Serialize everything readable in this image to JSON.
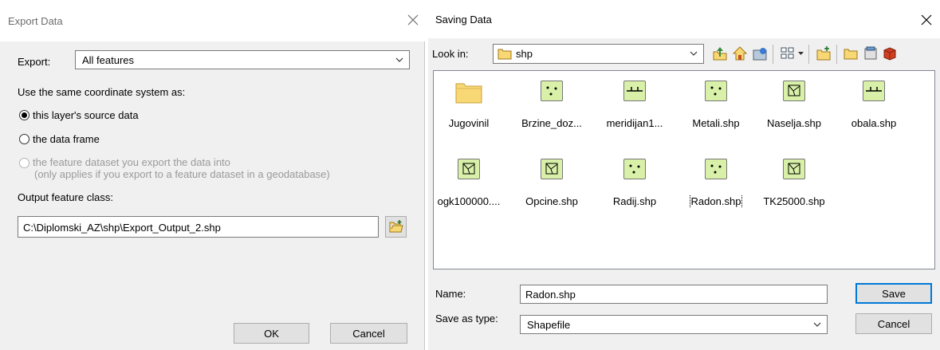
{
  "export_dialog": {
    "title": "Export Data",
    "export_label": "Export:",
    "export_value": "All features",
    "coord_label": "Use the same coordinate system as:",
    "options": [
      {
        "label": "this layer's source data"
      },
      {
        "label": "the data frame"
      },
      {
        "label": "the feature dataset you export the data into",
        "note": "(only applies if you export to a feature dataset in a geodatabase)"
      }
    ],
    "selected_option": 0,
    "output_label": "Output feature class:",
    "output_value": "C:\\Diplomski_AZ\\shp\\Export_Output_2.shp",
    "ok_label": "OK",
    "cancel_label": "Cancel"
  },
  "save_dialog": {
    "title": "Saving Data",
    "look_in_label": "Look in:",
    "look_in_value": "shp",
    "files": [
      {
        "name": "Jugovinil",
        "icon": "folder-icon"
      },
      {
        "name": "Brzine_doz...",
        "icon": "point-shapefile-icon"
      },
      {
        "name": "meridijan1...",
        "icon": "line-shapefile-icon"
      },
      {
        "name": "Metali.shp",
        "icon": "point-shapefile-icon"
      },
      {
        "name": "Naselja.shp",
        "icon": "polygon-shapefile-icon"
      },
      {
        "name": "obala.shp",
        "icon": "line-shapefile-icon"
      },
      {
        "name": "ogk100000....",
        "icon": "polygon-shapefile-icon"
      },
      {
        "name": "Opcine.shp",
        "icon": "polygon-shapefile-icon"
      },
      {
        "name": "Radij.shp",
        "icon": "point-shapefile-icon"
      },
      {
        "name": "Radon.shp",
        "icon": "point-shapefile-icon",
        "selected": true
      },
      {
        "name": "TK25000.shp",
        "icon": "polygon-shapefile-icon"
      }
    ],
    "name_label": "Name:",
    "name_value": "Radon.shp",
    "type_label": "Save as type:",
    "type_value": "Shapefile",
    "save_label": "Save",
    "cancel_label": "Cancel"
  },
  "colors": {
    "dialog_bg": "#f0f0f0",
    "accent": "#0078d7",
    "shapefile_green": "#d9f0a8",
    "folder_yellow": "#f8d775"
  }
}
